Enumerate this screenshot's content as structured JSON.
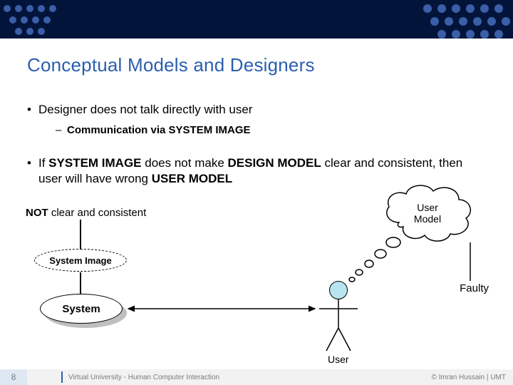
{
  "page_number": "8",
  "footer_center": "Virtual University - Human Computer Interaction",
  "footer_right": "© Imran Hussain | UMT",
  "title": "Conceptual Models and Designers",
  "bullets": {
    "b1": "Designer does not talk directly with user",
    "s1": "Communication via SYSTEM IMAGE",
    "b2_plain_prefix": "If ",
    "b2_bold1": "SYSTEM IMAGE",
    "b2_mid1": " does not make ",
    "b2_bold2": "DESIGN MODEL",
    "b2_mid2": " clear and consistent, then user will have wrong ",
    "b2_bold3": "USER MODEL"
  },
  "labels": {
    "not_bold": "NOT",
    "not_rest": " clear and consistent",
    "faulty": "Faulty",
    "system_image": "System Image",
    "system": "System",
    "user": "User",
    "user_model_l1": "User",
    "user_model_l2": "Model"
  }
}
